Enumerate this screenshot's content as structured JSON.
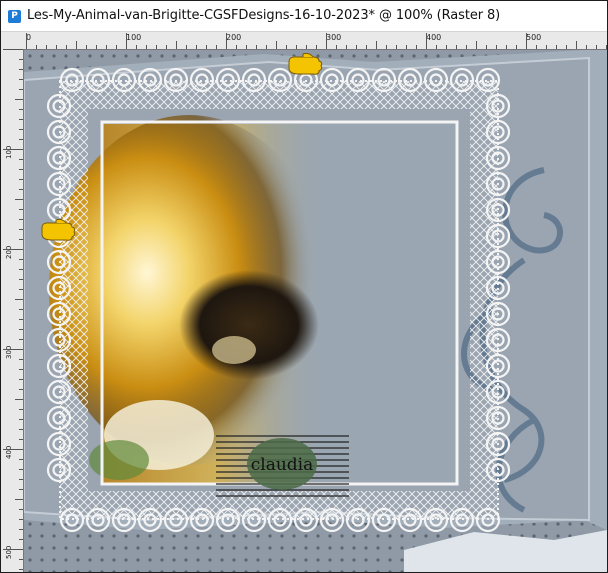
{
  "window": {
    "title": "Les-My-Animal-van-Brigitte-CGSFDesigns-16-10-2023* @ 100% (Raster 8)",
    "app_icon": "paintshop-pro-icon"
  },
  "ruler": {
    "labels": [
      "0",
      "100",
      "200",
      "300",
      "400",
      "500"
    ]
  },
  "artwork": {
    "watermark_text": "claudia",
    "pointer_icon": "pointing-hand-icon",
    "colors": {
      "background": "#9aa6b2",
      "lace": "#f4f4f4",
      "flower": "#e0a819",
      "swirl": "#4f6a86"
    }
  }
}
